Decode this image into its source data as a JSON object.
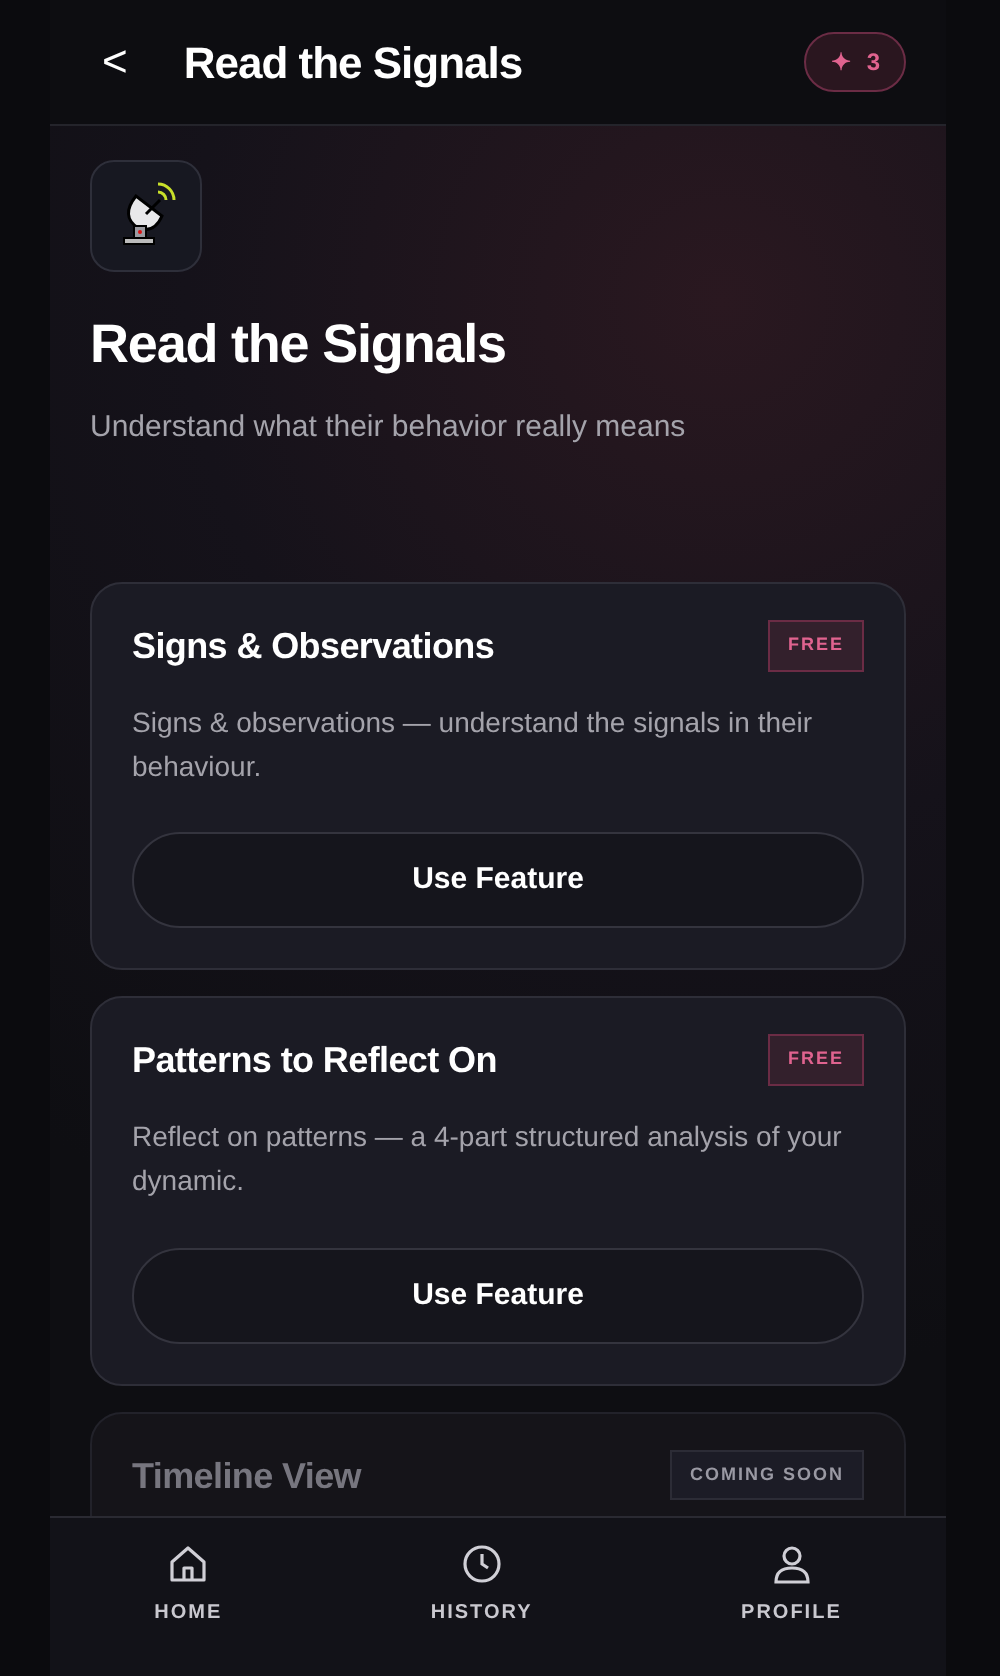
{
  "header": {
    "back": "<",
    "title": "Read the Signals",
    "credits": {
      "symbol": "✦",
      "count": "3"
    }
  },
  "hero": {
    "title": "Read the Signals",
    "subtitle": "Understand what their behavior really means"
  },
  "features": [
    {
      "title": "Signs & Observations",
      "badge": "FREE",
      "kind": "free",
      "disabled": false,
      "description": "Signs & observations — understand the signals in their behaviour.",
      "button": "Use Feature"
    },
    {
      "title": "Patterns to Reflect On",
      "badge": "FREE",
      "kind": "free",
      "disabled": false,
      "description": "Reflect on patterns — a 4-part structured analysis of your dynamic.",
      "button": "Use Feature"
    },
    {
      "title": "Timeline View",
      "badge": "COMING SOON",
      "kind": "coming_soon",
      "disabled": true
    }
  ],
  "nav": [
    {
      "label": "HOME",
      "kind": "home"
    },
    {
      "label": "HISTORY",
      "kind": "history"
    },
    {
      "label": "PROFILE",
      "kind": "profile"
    }
  ]
}
